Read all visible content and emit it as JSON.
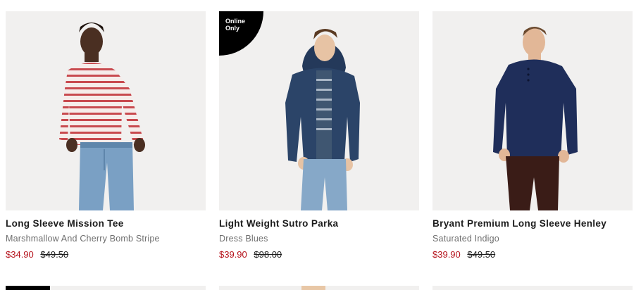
{
  "products": [
    {
      "name": "Long Sleeve Mission Tee",
      "color": "Marshmallow And Cherry Bomb Stripe",
      "sale_price": "$34.90",
      "original_price": "$49.50",
      "badge": ""
    },
    {
      "name": "Light Weight Sutro Parka",
      "color": "Dress Blues",
      "sale_price": "$39.90",
      "original_price": "$98.00",
      "badge": "Online Only"
    },
    {
      "name": "Bryant Premium Long Sleeve Henley",
      "color": "Saturated Indigo",
      "sale_price": "$39.90",
      "original_price": "$49.50",
      "badge": ""
    }
  ],
  "colors": {
    "sale_price": "#b5121b",
    "photo_background": "#f1f0ef",
    "badge_background": "#000000"
  }
}
